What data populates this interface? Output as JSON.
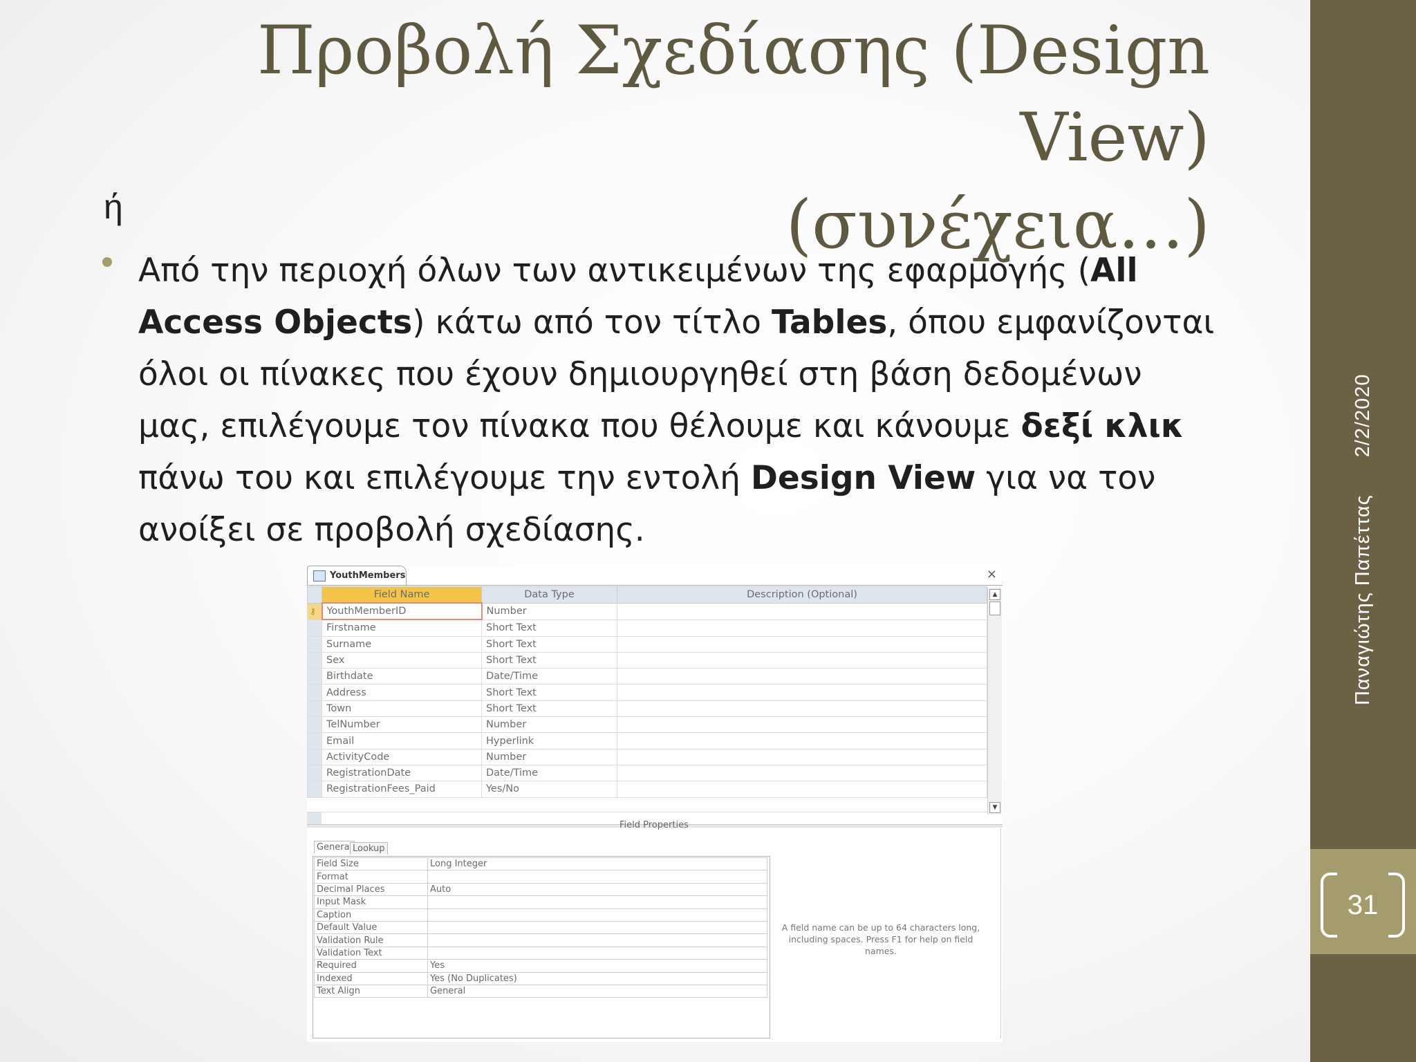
{
  "slide": {
    "title_line1": "Προβολή Σχεδίασης (Design View)",
    "title_line2": "(συνέχεια…)",
    "eta": "ή",
    "bullet": {
      "t1": "Από την περιοχή όλων των αντικειμένων της εφαρμογής (",
      "b1": "All Access Objects",
      "t2": ") κάτω από τον τίτλο ",
      "b2": "Tables",
      "t3": ", όπου εμφανίζονται όλοι οι πίνακες που έχουν δημιουργηθεί στη βάση δεδομένων μας, επιλέγουμε τον πίνακα που θέλουμε και κάνουμε ",
      "b3": "δεξί κλικ",
      "t4": " πάνω του και επιλέγουμε την εντολή ",
      "b4": "Design View",
      "t5": " για να τον ανοίξει σε προβολή σχεδίασης."
    },
    "author": "Παναγιώτης Παπέττας",
    "date": "2/2/2020",
    "page_number": "31"
  },
  "colors": {
    "sidebar": "#6b6246",
    "accent": "#a49c6c",
    "title": "#5f5940"
  },
  "access": {
    "tab_label": "YouthMembers",
    "close_label": "×",
    "headers": {
      "field_name": "Field Name",
      "data_type": "Data Type",
      "description": "Description (Optional)"
    },
    "fields": [
      {
        "name": "YouthMemberID",
        "type": "Number"
      },
      {
        "name": "Firstname",
        "type": "Short Text"
      },
      {
        "name": "Surname",
        "type": "Short Text"
      },
      {
        "name": "Sex",
        "type": "Short Text"
      },
      {
        "name": "Birthdate",
        "type": "Date/Time"
      },
      {
        "name": "Address",
        "type": "Short Text"
      },
      {
        "name": "Town",
        "type": "Short Text"
      },
      {
        "name": "TelNumber",
        "type": "Number"
      },
      {
        "name": "Email",
        "type": "Hyperlink"
      },
      {
        "name": "ActivityCode",
        "type": "Number"
      },
      {
        "name": "RegistrationDate",
        "type": "Date/Time"
      },
      {
        "name": "RegistrationFees_Paid",
        "type": "Yes/No"
      }
    ],
    "field_properties_title": "Field Properties",
    "tabs": {
      "general": "General",
      "lookup": "Lookup"
    },
    "properties": [
      {
        "name": "Field Size",
        "value": "Long Integer"
      },
      {
        "name": "Format",
        "value": ""
      },
      {
        "name": "Decimal Places",
        "value": "Auto"
      },
      {
        "name": "Input Mask",
        "value": ""
      },
      {
        "name": "Caption",
        "value": ""
      },
      {
        "name": "Default Value",
        "value": ""
      },
      {
        "name": "Validation Rule",
        "value": ""
      },
      {
        "name": "Validation Text",
        "value": ""
      },
      {
        "name": "Required",
        "value": "Yes"
      },
      {
        "name": "Indexed",
        "value": "Yes (No Duplicates)"
      },
      {
        "name": "Text Align",
        "value": "General"
      }
    ],
    "help_text": "A field name can be up to 64 characters long, including spaces. Press F1 for help on field names."
  }
}
